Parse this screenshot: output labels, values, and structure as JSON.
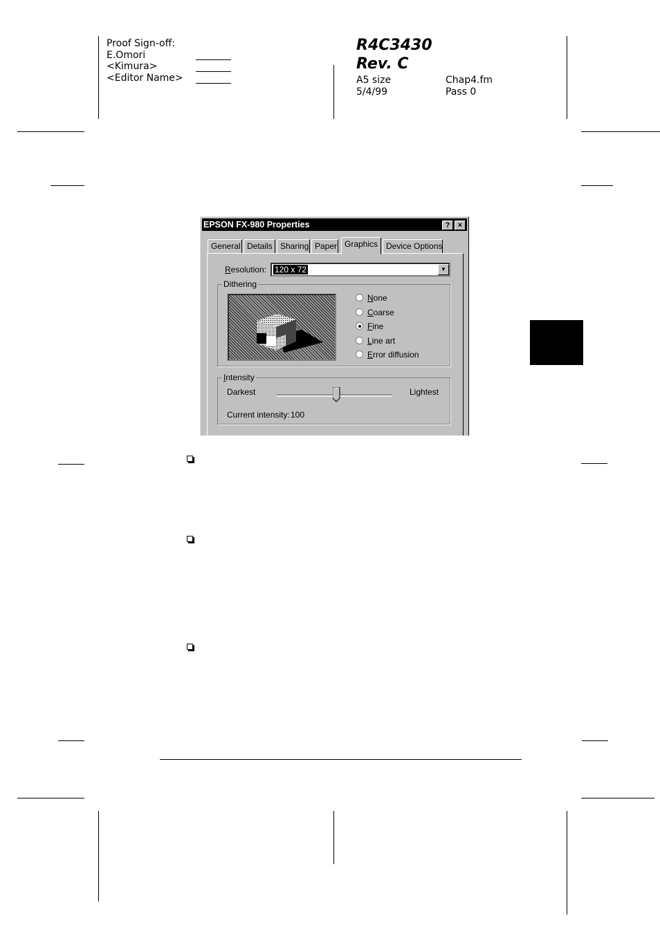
{
  "proof": {
    "title": "Proof Sign-off:",
    "names": [
      "E.Omori",
      "<Kimura>",
      "<Editor Name>"
    ]
  },
  "header": {
    "code": "R4C3430",
    "rev": "Rev. C",
    "size": "A5 size",
    "date": "5/4/99",
    "file": "Chap4.fm",
    "pass": "Pass 0"
  },
  "dialog": {
    "title": "EPSON FX-980 Properties",
    "help_button": "?",
    "close_button": "×",
    "tabs": [
      "General",
      "Details",
      "Sharing",
      "Paper",
      "Graphics",
      "Device Options"
    ],
    "active_tab": "Graphics",
    "resolution_label": "Resolution:",
    "resolution_value": "120 x 72",
    "dithering_label": "Dithering",
    "dithering_options": [
      "None",
      "Coarse",
      "Fine",
      "Line art",
      "Error diffusion"
    ],
    "dithering_selected": "Fine",
    "intensity_label": "Intensity",
    "darkest_label": "Darkest",
    "lightest_label": "Lightest",
    "current_intensity_label": "Current intensity:",
    "current_intensity_value": "100",
    "intensity_slider_fraction": 0.52
  },
  "icons": [
    "checkbox-bullet-icon",
    "cube-preview-icon",
    "dropdown-arrow-icon",
    "help-icon",
    "close-icon"
  ],
  "colors": {
    "dialog_face": "#c0c0c0",
    "titlebar": "#000000",
    "thumb_tab": "#000000"
  }
}
